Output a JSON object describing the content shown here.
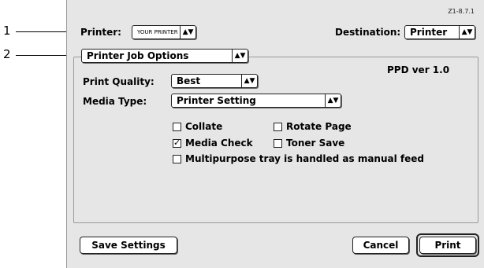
{
  "callouts": [
    "1",
    "2"
  ],
  "dialog": {
    "version": "Z1-8.7.1",
    "printer_label": "Printer:",
    "printer_value": "YOUR PRINTER",
    "destination_label": "Destination:",
    "destination_value": "Printer",
    "panel_value": "Printer Job Options",
    "ppd": "PPD ver 1.0",
    "print_quality_label": "Print Quality:",
    "print_quality_value": "Best",
    "media_type_label": "Media Type:",
    "media_type_value": "Printer Setting",
    "checkboxes": [
      {
        "label": "Collate",
        "checked": false
      },
      {
        "label": "Rotate Page",
        "checked": false
      },
      {
        "label": "Media Check",
        "checked": true
      },
      {
        "label": "Toner Save",
        "checked": false
      },
      {
        "label": "Multipurpose tray is handled as manual feed",
        "checked": false
      }
    ],
    "buttons": {
      "save": "Save Settings",
      "cancel": "Cancel",
      "print": "Print"
    }
  },
  "colors": {
    "callout_dot": "#dd1111",
    "dialog_bg": "#e6e6e6"
  }
}
